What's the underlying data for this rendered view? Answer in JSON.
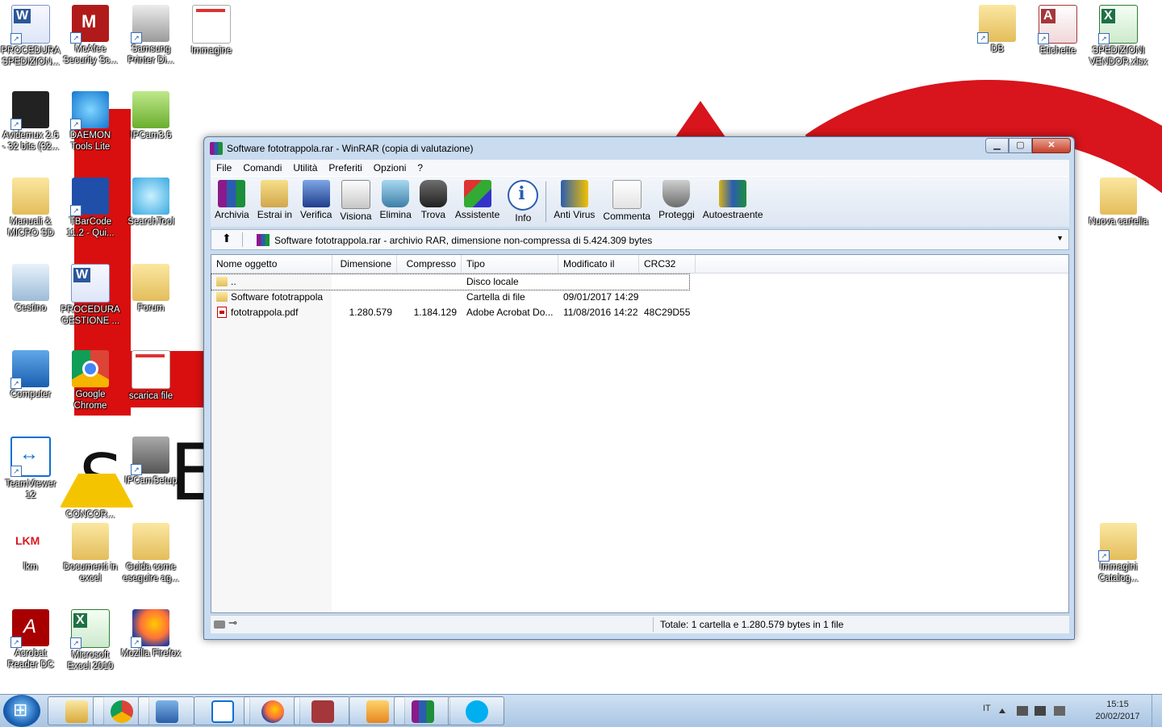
{
  "desktop": {
    "icons": [
      {
        "label": "PROCEDURA SPEDIZION...",
        "icon": "word-doc-icon"
      },
      {
        "label": "McAfee Security Sc...",
        "icon": "mcafee-icon"
      },
      {
        "label": "Samsung Printer Di...",
        "icon": "printer-icon"
      },
      {
        "label": "Immagine",
        "icon": "image-icon"
      },
      {
        "label": "Avidemux 2.6 - 32 bits (32...",
        "icon": "film-clapper-icon"
      },
      {
        "label": "DAEMON Tools Lite",
        "icon": "daemon-tools-icon"
      },
      {
        "label": "IPCam3.6",
        "icon": "ipcam-icon"
      },
      {
        "label": "Manuali & MICRO SD",
        "icon": "folder-icon"
      },
      {
        "label": "TBarCode 11.2 - Qui...",
        "icon": "barcode-icon"
      },
      {
        "label": "SearchTool",
        "icon": "search-tool-icon"
      },
      {
        "label": "Cestino",
        "icon": "recycle-bin-icon"
      },
      {
        "label": "PROCEDURA GESTIONE ...",
        "icon": "word-doc-icon"
      },
      {
        "label": "Forum",
        "icon": "folder-icon"
      },
      {
        "label": "Computer",
        "icon": "computer-icon"
      },
      {
        "label": "Google Chrome",
        "icon": "chrome-icon"
      },
      {
        "label": "scarica file",
        "icon": "image-icon"
      },
      {
        "label": "TeamViewer 12",
        "icon": "teamviewer-icon"
      },
      {
        "label": "CONCOR...",
        "icon": "warning-icon"
      },
      {
        "label": "IPCamSetup",
        "icon": "setup-icon"
      },
      {
        "label": "lkm",
        "icon": "lkm-icon"
      },
      {
        "label": "Documenti in excel",
        "icon": "folder-icon"
      },
      {
        "label": "Guida come eseguire ag...",
        "icon": "folder-icon"
      },
      {
        "label": "Acrobat Reader DC",
        "icon": "acrobat-icon"
      },
      {
        "label": "Microsoft Excel 2010",
        "icon": "excel-icon"
      },
      {
        "label": "Mozilla Firefox",
        "icon": "firefox-icon"
      },
      {
        "label": "DB",
        "icon": "folder-icon"
      },
      {
        "label": "Etichette",
        "icon": "access-icon"
      },
      {
        "label": "SPEDIZIONI VENDOR.xlsx",
        "icon": "excel-icon"
      },
      {
        "label": "Nuova cartella",
        "icon": "folder-icon"
      },
      {
        "label": "Immagini Catalog...",
        "icon": "folder-icon"
      }
    ]
  },
  "window": {
    "title": "Software fototrappola.rar - WinRAR (copia di valutazione)",
    "controls": {
      "minimize": "▁",
      "maximize": "▢",
      "close": "✕"
    },
    "menu": [
      "File",
      "Comandi",
      "Utilità",
      "Preferiti",
      "Opzioni",
      "?"
    ],
    "toolbar": [
      {
        "label": "Archivia",
        "icon": "archive-icon"
      },
      {
        "label": "Estrai in",
        "icon": "extract-icon"
      },
      {
        "label": "Verifica",
        "icon": "test-icon"
      },
      {
        "label": "Visiona",
        "icon": "view-icon"
      },
      {
        "label": "Elimina",
        "icon": "delete-icon"
      },
      {
        "label": "Trova",
        "icon": "find-icon"
      },
      {
        "label": "Assistente",
        "icon": "wizard-icon"
      },
      {
        "label": "Info",
        "icon": "info-icon"
      },
      {
        "label": "Anti Virus",
        "icon": "antivirus-icon"
      },
      {
        "label": "Commenta",
        "icon": "comment-icon"
      },
      {
        "label": "Proteggi",
        "icon": "protect-icon"
      },
      {
        "label": "Autoestraente",
        "icon": "sfx-icon"
      }
    ],
    "path": "Software fototrappola.rar - archivio RAR, dimensione non-compressa di 5.424.309 bytes",
    "columns": [
      "Nome oggetto",
      "Dimensione",
      "Compresso",
      "Tipo",
      "Modificato il",
      "CRC32"
    ],
    "rows": [
      {
        "name": "..",
        "size": "",
        "packed": "",
        "type": "Disco locale",
        "modified": "",
        "crc": "",
        "icon": "folder-icon"
      },
      {
        "name": "Software fototrappola",
        "size": "",
        "packed": "",
        "type": "Cartella di file",
        "modified": "09/01/2017 14:29",
        "crc": "",
        "icon": "folder-icon"
      },
      {
        "name": "fototrappola.pdf",
        "size": "1.280.579",
        "packed": "1.184.129",
        "type": "Adobe Acrobat Do...",
        "modified": "11/08/2016 14:22",
        "crc": "48C29D55",
        "icon": "pdf-file-icon"
      }
    ],
    "status": "Totale: 1 cartella e 1.280.579 bytes in 1 file"
  },
  "taskbar": {
    "apps": [
      "explorer-icon",
      "chrome-icon",
      "remote-desktop-icon",
      "teamviewer-icon",
      "firefox-icon",
      "access-icon",
      "media-player-icon",
      "winrar-icon",
      "skype-icon"
    ],
    "language": "IT",
    "time": "15:15",
    "date": "20/02/2017"
  },
  "colors": {
    "accent": "#2a5db0",
    "wallpaper_red": "#d90f0f",
    "taskbar": "#bcd3ec"
  }
}
